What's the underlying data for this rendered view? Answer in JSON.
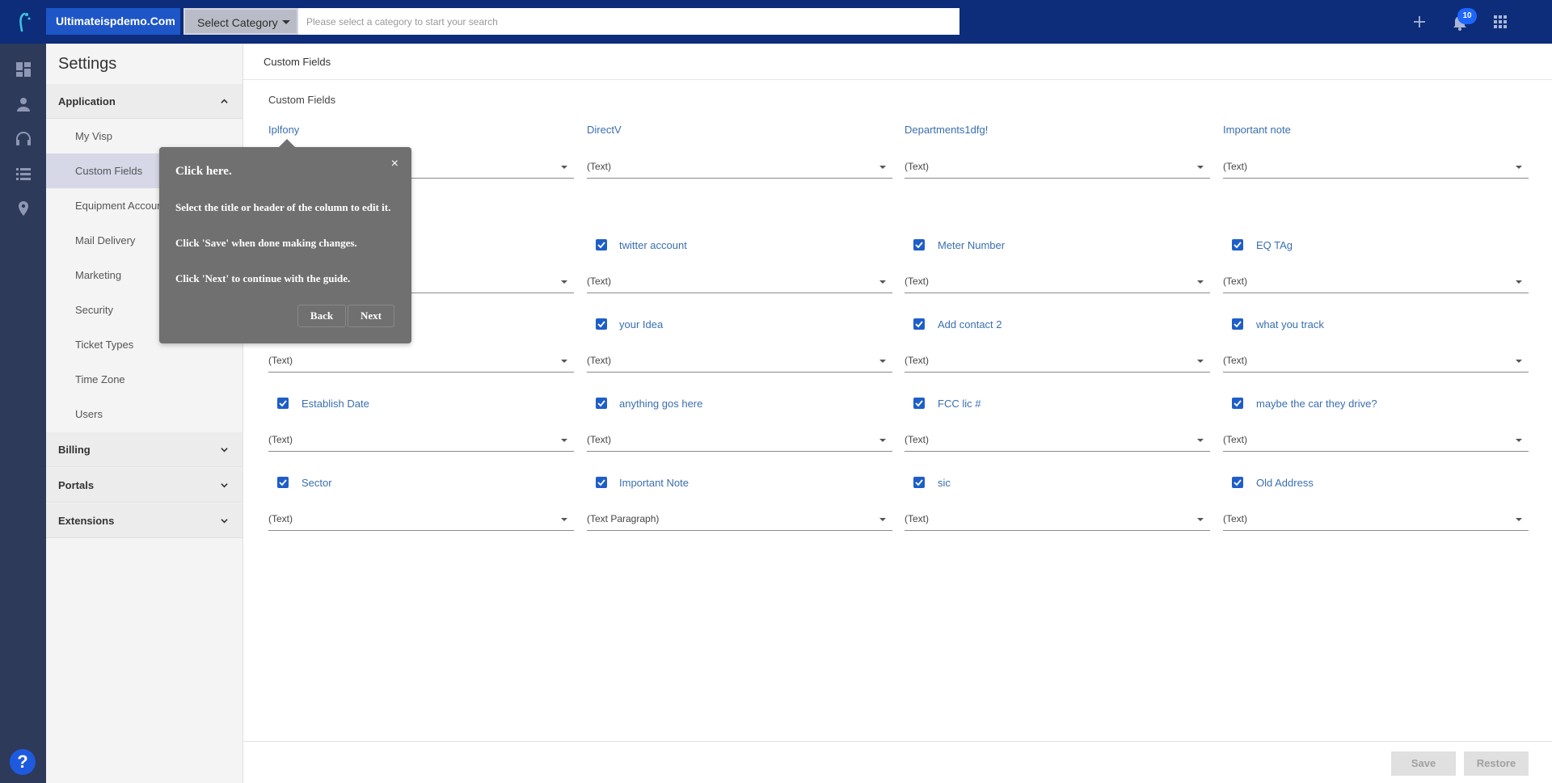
{
  "topbar": {
    "brand": "Ultimateispdemo.Com",
    "category_select": "Select Category",
    "search_placeholder": "Please select a category to start your search",
    "notification_count": "10",
    "icons": [
      "add-icon",
      "bell-icon",
      "apps-grid-icon"
    ]
  },
  "rail": {
    "icons": [
      "dashboard-icon",
      "person-icon",
      "headset-icon",
      "list-icon",
      "location-pin-icon"
    ],
    "help": "?"
  },
  "sidebar": {
    "title": "Settings",
    "sections": [
      {
        "label": "Application",
        "expanded": true
      },
      {
        "label": "Billing",
        "expanded": false
      },
      {
        "label": "Portals",
        "expanded": false
      },
      {
        "label": "Extensions",
        "expanded": false
      }
    ],
    "items": [
      "My Visp",
      "Custom Fields",
      "Equipment Accounts",
      "Mail Delivery",
      "Marketing",
      "Security",
      "Ticket Types",
      "Time Zone",
      "Users"
    ]
  },
  "main": {
    "header": "Custom Fields",
    "section_title": "Custom Fields",
    "rows": [
      [
        {
          "label": "Iplfony",
          "checked": false,
          "type": "(Text)"
        },
        {
          "label": "DirectV",
          "checked": false,
          "type": "(Text)"
        },
        {
          "label": "Departments1dfg!",
          "checked": false,
          "type": "(Text)"
        },
        {
          "label": "Important note",
          "checked": false,
          "type": "(Text)"
        }
      ],
      [
        {
          "label": "",
          "checked": false,
          "type": ""
        },
        {
          "label": "twitter account",
          "checked": true,
          "type": "(Text)"
        },
        {
          "label": "Meter Number",
          "checked": true,
          "type": "(Text)"
        },
        {
          "label": "EQ TAg",
          "checked": true,
          "type": "(Text)"
        }
      ],
      [
        {
          "label": "",
          "checked": false,
          "type": "(Text)"
        },
        {
          "label": "your Idea",
          "checked": true,
          "type": "(Text)"
        },
        {
          "label": "Add contact 2",
          "checked": true,
          "type": "(Text)"
        },
        {
          "label": "what you track",
          "checked": true,
          "type": "(Text)"
        }
      ],
      [
        {
          "label": "Establish Date",
          "checked": true,
          "type": "(Text)"
        },
        {
          "label": "anything gos here",
          "checked": true,
          "type": "(Text)"
        },
        {
          "label": "FCC lic #",
          "checked": true,
          "type": "(Text)"
        },
        {
          "label": "maybe the car they drive?",
          "checked": true,
          "type": "(Text)"
        }
      ],
      [
        {
          "label": "Sector",
          "checked": true,
          "type": "(Text)"
        },
        {
          "label": "Important Note",
          "checked": true,
          "type": "(Text Paragraph)"
        },
        {
          "label": "sic",
          "checked": true,
          "type": "(Text)"
        },
        {
          "label": "Old Address",
          "checked": true,
          "type": "(Text)"
        }
      ]
    ]
  },
  "footer": {
    "save": "Save",
    "restore": "Restore"
  },
  "tour": {
    "close": "×",
    "title": "Click here.",
    "line1": "Select the title or header of the column to edit it.",
    "line2": "Click 'Save' when done making changes.",
    "line3": "Click 'Next' to continue with the guide.",
    "back": "Back",
    "next": "Next"
  }
}
